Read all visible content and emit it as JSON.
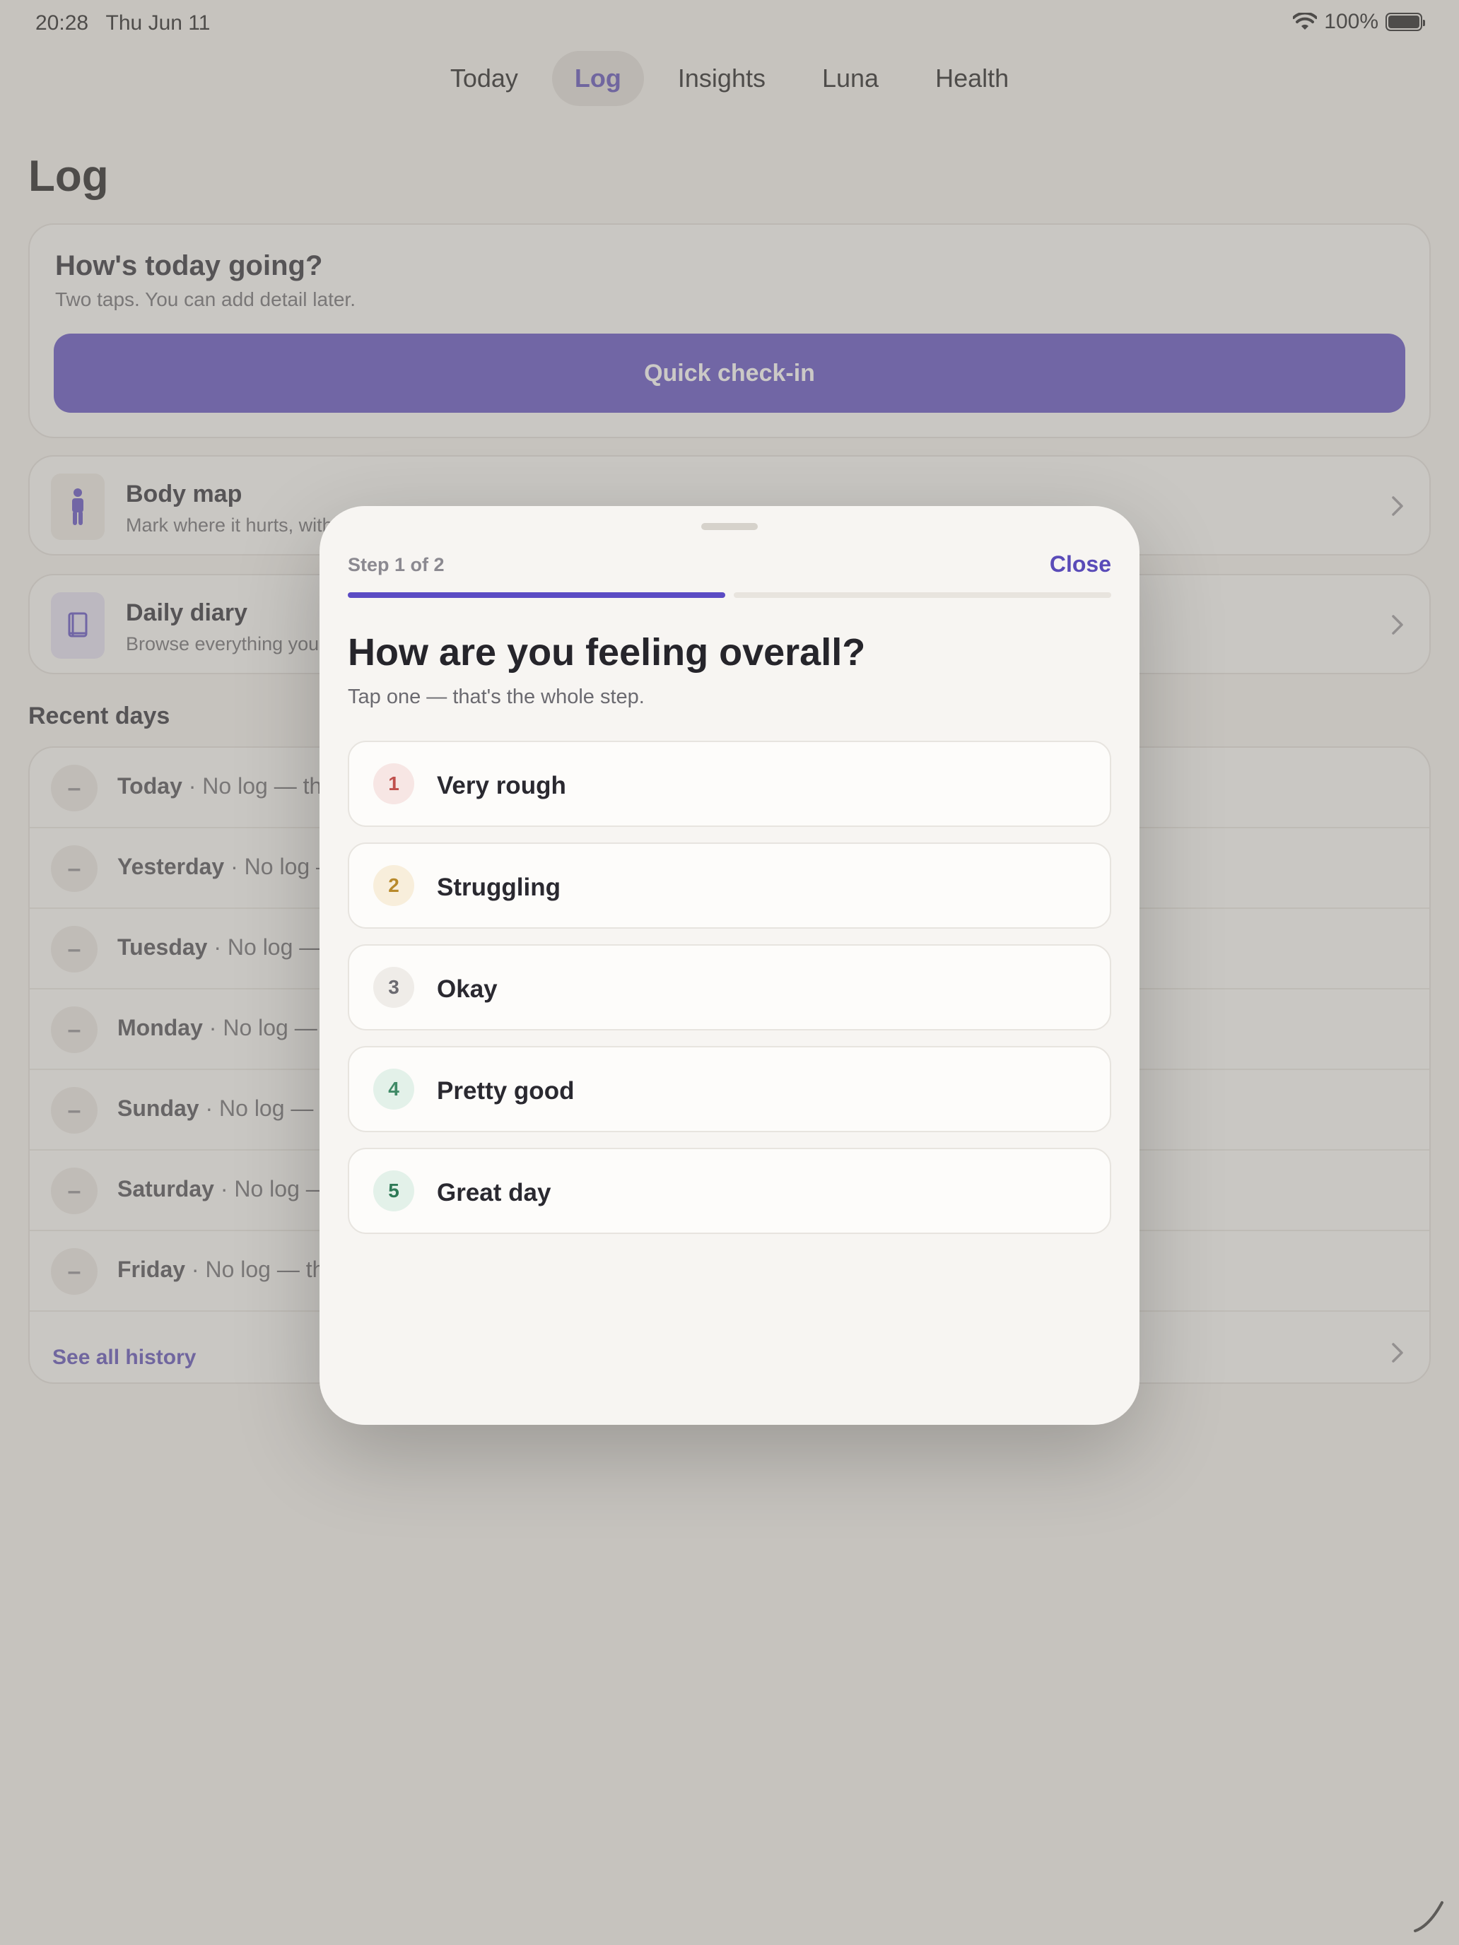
{
  "status_bar": {
    "time": "20:28",
    "date": "Thu Jun 11",
    "battery": "100%"
  },
  "tabs": [
    {
      "label": "Today",
      "active": false
    },
    {
      "label": "Log",
      "active": true
    },
    {
      "label": "Insights",
      "active": false
    },
    {
      "label": "Luna",
      "active": false
    },
    {
      "label": "Health",
      "active": false
    }
  ],
  "page_title": "Log",
  "checkin": {
    "title": "How's today going?",
    "subtitle": "Two taps. You can add detail later.",
    "button_label": "Quick check-in"
  },
  "body_map": {
    "title": "Body map",
    "subtitle": "Mark where it hurts, with"
  },
  "daily_diary": {
    "title": "Daily diary",
    "subtitle": "Browse everything you"
  },
  "recent": {
    "title": "Recent days",
    "items": [
      {
        "day": "Today",
        "text": " · No log — tha"
      },
      {
        "day": "Yesterday",
        "text": " · No log —"
      },
      {
        "day": "Tuesday",
        "text": " · No log — t"
      },
      {
        "day": "Monday",
        "text": " · No log — t"
      },
      {
        "day": "Sunday",
        "text": " · No log — th"
      },
      {
        "day": "Saturday",
        "text": " · No log —"
      },
      {
        "day": "Friday",
        "text": " · No log — tha"
      }
    ],
    "see_all": "See all history"
  },
  "sheet": {
    "step_label": "Step 1 of 2",
    "close_label": "Close",
    "progress_step": 1,
    "progress_total": 2,
    "question": "How are you feeling overall?",
    "hint": "Tap one — that's the whole step.",
    "options": [
      {
        "num": "1",
        "label": "Very rough",
        "num_color": "#c0504d",
        "num_bg": "#f7e6e4"
      },
      {
        "num": "2",
        "label": "Struggling",
        "num_color": "#b8892b",
        "num_bg": "#f8eedb"
      },
      {
        "num": "3",
        "label": "Okay",
        "num_color": "#6b6a70",
        "num_bg": "#efece8"
      },
      {
        "num": "4",
        "label": "Pretty good",
        "num_color": "#3f8a66",
        "num_bg": "#e3f1e9"
      },
      {
        "num": "5",
        "label": "Great day",
        "num_color": "#2f7a57",
        "num_bg": "#e3f1e9"
      }
    ]
  },
  "colors": {
    "accent": "#5b4bc4",
    "background": "#f6f4f1",
    "dim": "#8c8880"
  }
}
